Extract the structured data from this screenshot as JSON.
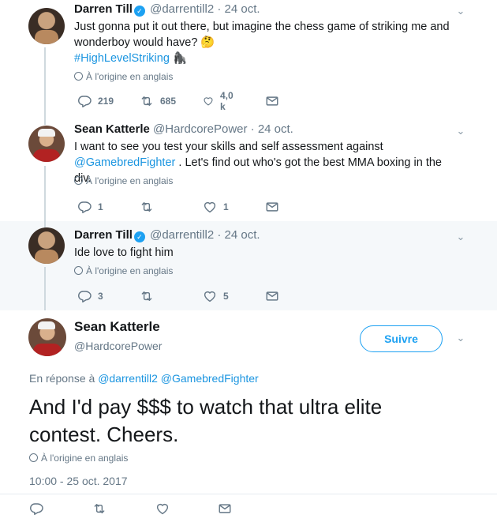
{
  "tweets": [
    {
      "name": "Darren Till",
      "handle": "@darrentill2",
      "time": "· 24 oct.",
      "text_line1": "Just gonna put it out there, but imagine the chess game of striking me and",
      "text_line2": "wonderboy would have? 🤔",
      "hashtag": "#HighLevelStriking",
      "emoji": "🦍",
      "origin": "À l'origine en anglais",
      "replies": "219",
      "retweets": "685",
      "likes": "4,0 k"
    },
    {
      "name": "Sean Katterle",
      "handle": "@HardcorePower",
      "time": "· 24 oct.",
      "text_line1": "I want to see you test your skills and self assessment against",
      "mention": "@GamebredFighter",
      "text_line2_rest": ". Let's find out who's got the best MMA boxing in the div.",
      "origin": "À l'origine en anglais",
      "replies": "1",
      "retweets": "",
      "likes": "1"
    },
    {
      "name": "Darren Till",
      "handle": "@darrentill2",
      "time": "· 24 oct.",
      "text": "Ide love to fight him",
      "origin": "À l'origine en anglais",
      "replies": "3",
      "retweets": "",
      "likes": "5"
    }
  ],
  "main": {
    "name": "Sean Katterle",
    "handle": "@HardcorePower",
    "follow_label": "Suivre",
    "reply_prefix": "En réponse à",
    "reply_mention1": "@darrentill2",
    "reply_mention2": "@GamebredFighter",
    "text_line1": "And I'd pay $$$ to watch that ultra elite",
    "text_line2": "contest. Cheers.",
    "origin": "À l'origine en anglais",
    "timestamp": "10:00 - 25 oct. 2017"
  },
  "icons": {
    "verified": "verified-badge-icon",
    "reply": "reply-icon",
    "retweet": "retweet-icon",
    "like": "heart-icon",
    "dm": "envelope-icon",
    "caret": "chevron-down-icon",
    "globe": "globe-icon"
  },
  "colors": {
    "accent": "#1da1f2",
    "link": "#1b95e0",
    "muted": "#657786",
    "thread_bg": "#f5f8fa"
  }
}
